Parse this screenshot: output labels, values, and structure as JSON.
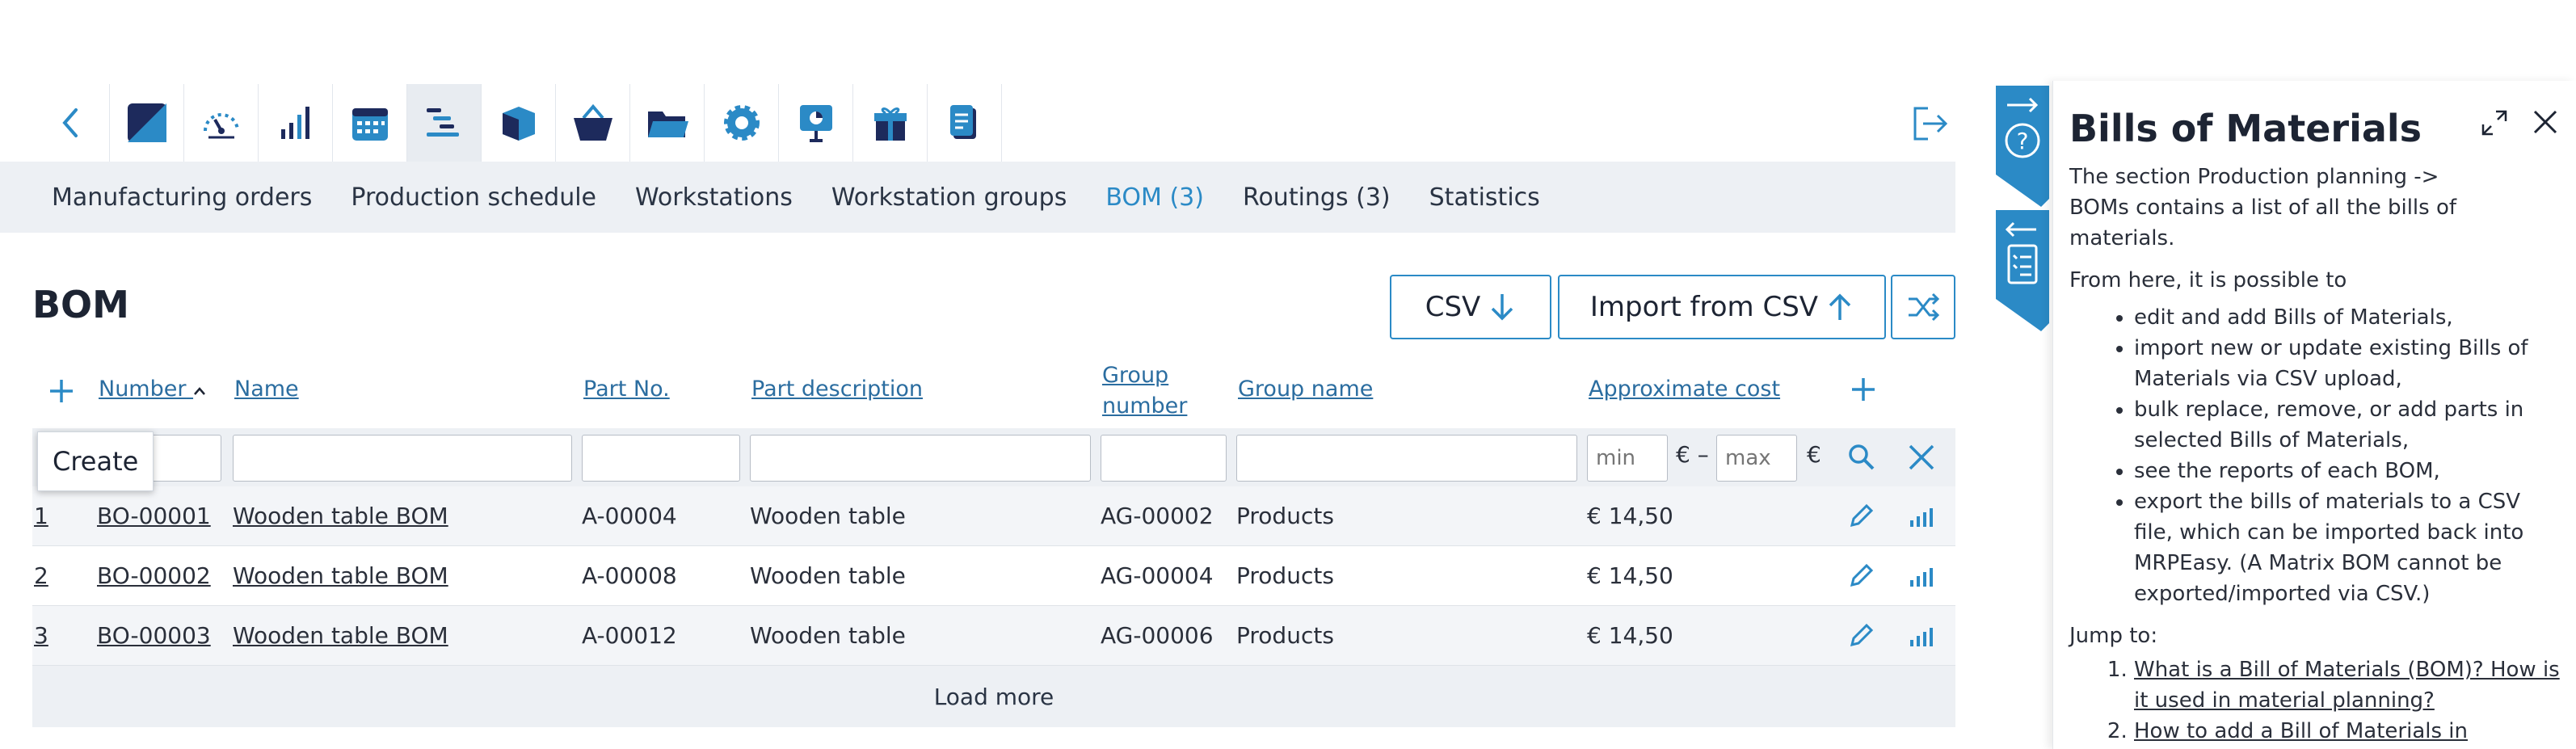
{
  "nav": {
    "icons": [
      "back-icon",
      "dashboard-logo-icon",
      "gauge-icon",
      "signal-bars-icon",
      "calendar-icon",
      "production-planning-icon",
      "box-icon",
      "basket-icon",
      "folder-icon",
      "settings-gear-icon",
      "presentation-icon",
      "gift-icon",
      "document-icon"
    ],
    "active_index": 5,
    "logout_icon": "logout-icon"
  },
  "subnav": {
    "items": [
      {
        "label": "Manufacturing orders"
      },
      {
        "label": "Production schedule"
      },
      {
        "label": "Workstations"
      },
      {
        "label": "Workstation groups"
      },
      {
        "label": "BOM (3)",
        "active": true
      },
      {
        "label": "Routings (3)"
      },
      {
        "label": "Statistics"
      }
    ]
  },
  "page": {
    "title": "BOM",
    "csv_button": "CSV",
    "import_button": "Import from CSV",
    "shuffle_icon": "shuffle-icon"
  },
  "table": {
    "headers": {
      "number": "Number",
      "name": "Name",
      "part_no": "Part No.",
      "part_description": "Part description",
      "group_number": "Group number",
      "group_name": "Group name",
      "approx_cost": "Approximate cost"
    },
    "filters": {
      "min_placeholder": "min",
      "max_placeholder": "max",
      "currency": "€",
      "range_separator": "€ –"
    },
    "rows": [
      {
        "index": "1",
        "number": "BO-00001",
        "name": "Wooden table BOM",
        "part_no": "A-00004",
        "part_description": "Wooden table",
        "group_number": "AG-00002",
        "group_name": "Products",
        "cost": "€ 14,50"
      },
      {
        "index": "2",
        "number": "BO-00002",
        "name": "Wooden table BOM",
        "part_no": "A-00008",
        "part_description": "Wooden table",
        "group_number": "AG-00004",
        "group_name": "Products",
        "cost": "€ 14,50"
      },
      {
        "index": "3",
        "number": "BO-00003",
        "name": "Wooden table BOM",
        "part_no": "A-00012",
        "part_description": "Wooden table",
        "group_number": "AG-00006",
        "group_name": "Products",
        "cost": "€ 14,50"
      }
    ],
    "load_more": "Load more",
    "tooltip": "Create"
  },
  "help": {
    "title": "Bills of Materials",
    "intro_1": "The section Production planning ->",
    "intro_2": "BOMs contains a list of all the bills of materials.",
    "possible": "From here, it is possible to",
    "bullets": [
      "edit and add Bills of Materials,",
      "import new or update existing Bills of Materials via CSV upload,",
      "bulk replace, remove, or add parts in selected Bills of Materials,",
      "see the reports of each BOM,",
      "export the bills of materials to a CSV file, which can be imported back into MRPEasy. (A Matrix BOM cannot be exported/imported via CSV.)"
    ],
    "jump_to": "Jump to:",
    "links": [
      "What is a Bill of Materials (BOM)? How is it used in material planning?",
      "How to add a Bill of Materials in MRPEasy?"
    ]
  },
  "colors": {
    "accent": "#2b8ac6",
    "navy": "#1d2a5c",
    "subnav_bg": "#edf0f4"
  }
}
